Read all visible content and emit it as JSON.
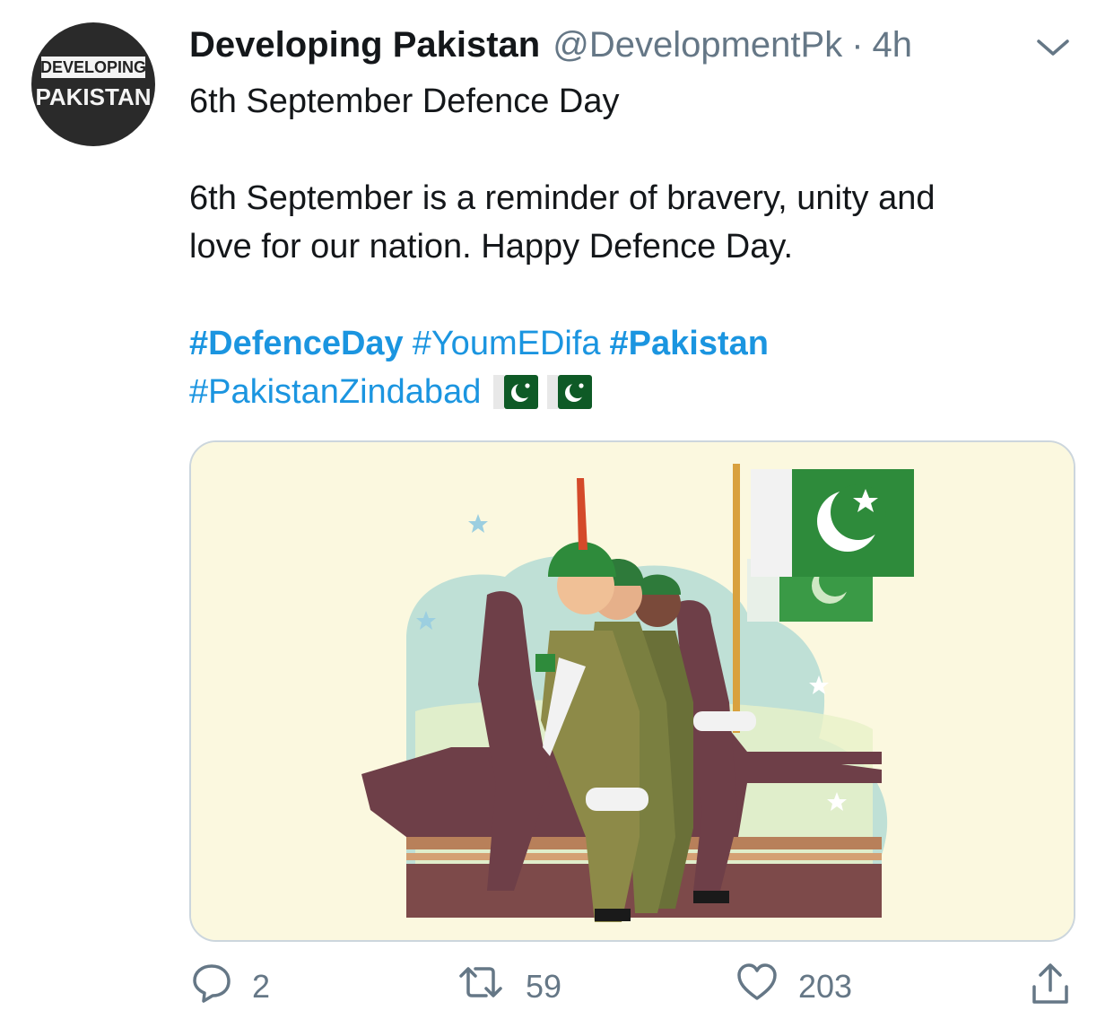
{
  "tweet": {
    "author": {
      "display_name": "Developing Pakistan",
      "handle": "@DevelopmentPk",
      "avatar_text_top": "DEVELOPING",
      "avatar_text_bottom": "PAKISTAN"
    },
    "separator": "·",
    "time": "4h",
    "title_line": "6th September Defence Day",
    "body_line1": "6th September is a reminder of bravery, unity and",
    "body_line2": "love for our nation. Happy Defence Day.",
    "hashtags": [
      "#DefenceDay",
      "#YoumEDifa",
      "#Pakistan",
      "#PakistanZindabad"
    ],
    "emoji": [
      "pakistan-flag-emoji",
      "pakistan-flag-emoji"
    ],
    "media_description_icon": "marching-soldiers-illustration",
    "actions": {
      "reply": {
        "icon": "reply-icon",
        "count": "2"
      },
      "retweet": {
        "icon": "retweet-icon",
        "count": "59"
      },
      "like": {
        "icon": "heart-icon",
        "count": "203"
      },
      "share": {
        "icon": "share-icon"
      }
    }
  },
  "colors": {
    "link": "#1b95e0",
    "muted": "#657786",
    "flag_green": "#1e7a32",
    "media_bg": "#fbf8df"
  }
}
